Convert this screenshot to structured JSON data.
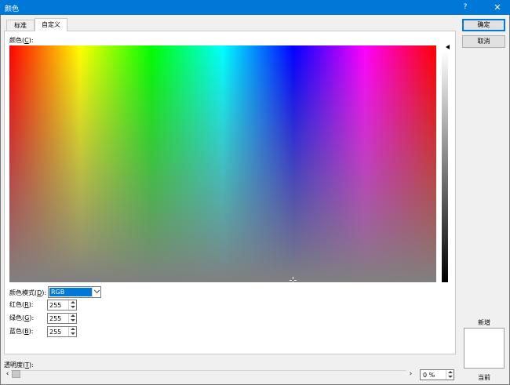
{
  "window": {
    "title": "颜色",
    "help_label": "?",
    "close_label": "✕"
  },
  "tabs": [
    {
      "label": "标准",
      "selected": false
    },
    {
      "label": "自定义",
      "selected": true
    }
  ],
  "custom": {
    "colors_label_prefix": "颜色(",
    "colors_label_key": "C",
    "colors_label_suffix": "):",
    "color_mode": {
      "label_prefix": "颜色模式(",
      "label_key": "D",
      "label_suffix": "):",
      "value": "RGB"
    },
    "fields": [
      {
        "label_prefix": "红色(",
        "label_key": "R",
        "label_suffix": "):",
        "value": "255"
      },
      {
        "label_prefix": "绿色(",
        "label_key": "G",
        "label_suffix": "):",
        "value": "255"
      },
      {
        "label_prefix": "蓝色(",
        "label_key": "B",
        "label_suffix": "):",
        "value": "255"
      }
    ]
  },
  "buttons": {
    "ok": "确定",
    "cancel": "取消"
  },
  "preview": {
    "new_label": "新增",
    "current_label": "当前",
    "color": "#ffffff"
  },
  "transparency": {
    "label_prefix": "透明度(",
    "label_key": "T",
    "label_suffix": "):",
    "value": "0 %",
    "level_percent": 0
  },
  "colors": {
    "accent": "#0078d7"
  }
}
